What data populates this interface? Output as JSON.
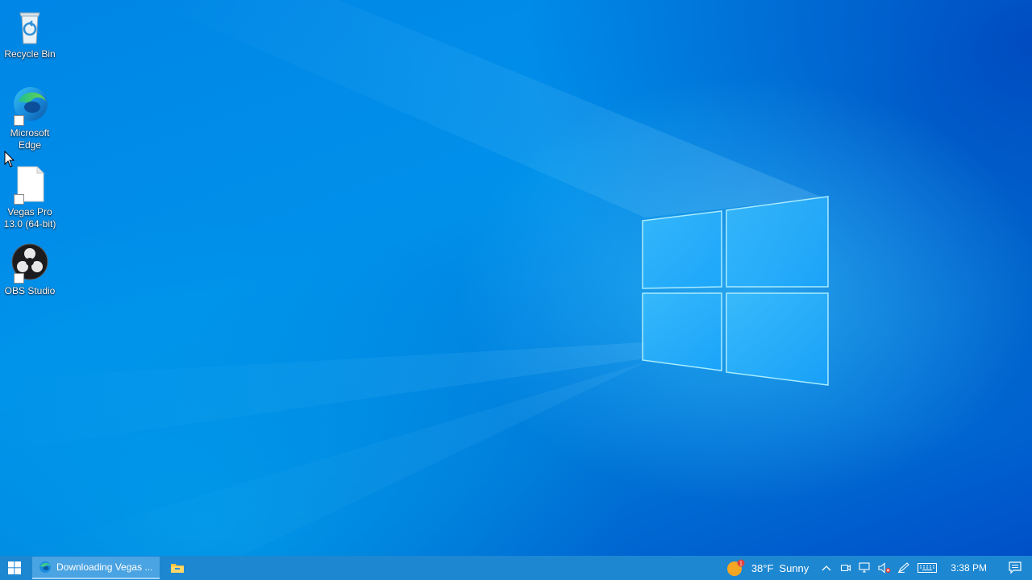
{
  "desktop": {
    "icons": [
      {
        "label": "Recycle Bin",
        "icon": "recycle-bin-icon",
        "shortcut": false
      },
      {
        "label": "Microsoft\nEdge",
        "icon": "edge-icon",
        "shortcut": true
      },
      {
        "label": "Vegas Pro\n13.0 (64-bit)",
        "icon": "blank-file-icon",
        "shortcut": true
      },
      {
        "label": "OBS Studio",
        "icon": "obs-icon",
        "shortcut": true
      }
    ]
  },
  "taskbar": {
    "start_icon": "windows-start-icon",
    "active_app": {
      "icon": "edge-icon",
      "label": "Downloading Vegas ..."
    },
    "pinned": [
      {
        "icon": "file-explorer-icon"
      }
    ],
    "weather": {
      "icon": "sun-icon",
      "badge": "1",
      "temperature": "38°F",
      "condition": "Sunny"
    },
    "tray_icons": [
      "chevron-up-icon",
      "meet-now-icon",
      "network-icon",
      "volume-muted-icon",
      "pen-icon",
      "keyboard-icon"
    ],
    "clock": "3:38 PM",
    "notification_icon": "action-center-icon"
  },
  "colors": {
    "taskbar": "#1d87d1",
    "active_app": "#4aa3e2",
    "wallpaper": "#0086e6"
  }
}
